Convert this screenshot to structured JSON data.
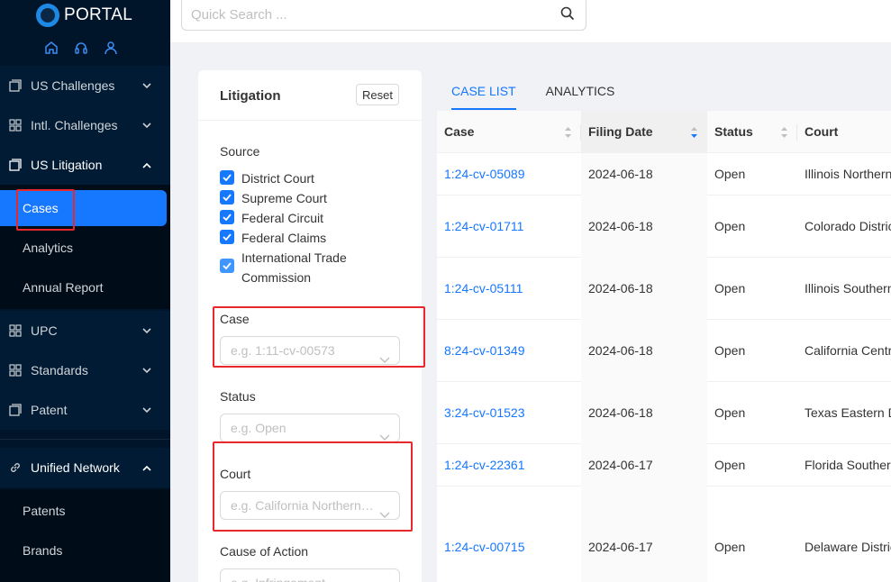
{
  "app": {
    "title": "PORTAL"
  },
  "sidebar": {
    "top_icons": [
      "home-icon",
      "headset-icon",
      "user-icon"
    ],
    "items": [
      {
        "label": "US Challenges",
        "icon": "window-icon",
        "expanded": false
      },
      {
        "label": "Intl. Challenges",
        "icon": "grid-icon",
        "expanded": false
      },
      {
        "label": "US Litigation",
        "icon": "window-icon",
        "expanded": true,
        "children": [
          {
            "label": "Cases",
            "active": true
          },
          {
            "label": "Analytics"
          },
          {
            "label": "Annual Report"
          }
        ]
      },
      {
        "label": "UPC",
        "icon": "grid-icon",
        "expanded": false
      },
      {
        "label": "Standards",
        "icon": "grid-icon",
        "expanded": false
      },
      {
        "label": "Patent",
        "icon": "window-icon",
        "expanded": false
      },
      {
        "label": "Unified Network",
        "icon": "link-icon",
        "expanded": true,
        "children": [
          {
            "label": "Patents"
          },
          {
            "label": "Brands"
          }
        ]
      }
    ]
  },
  "search": {
    "placeholder": "Quick Search ..."
  },
  "filters": {
    "title": "Litigation",
    "reset_label": "Reset",
    "source_label": "Source",
    "sources": [
      "District Court",
      "Supreme Court",
      "Federal Circuit",
      "Federal Claims",
      "International Trade Commission"
    ],
    "case_label": "Case",
    "case_placeholder": "e.g. 1:11-cv-00573",
    "status_label": "Status",
    "status_placeholder": "e.g. Open",
    "court_label": "Court",
    "court_placeholder": "e.g. California Northern District Court",
    "cause_label": "Cause of Action",
    "cause_placeholder": "e.g. Infringement"
  },
  "tabs": [
    {
      "label": "CASE LIST",
      "active": true
    },
    {
      "label": "ANALYTICS",
      "active": false
    }
  ],
  "table": {
    "columns": [
      "Case",
      "Filing Date",
      "Status",
      "Court"
    ],
    "sorted_column": "Filing Date",
    "rows": [
      {
        "case": "1:24-cv-05089",
        "date": "2024-06-18",
        "status": "Open",
        "court": "Illinois Northern District Court"
      },
      {
        "case": "1:24-cv-01711",
        "date": "2024-06-18",
        "status": "Open",
        "court": "Colorado District Court"
      },
      {
        "case": "1:24-cv-05111",
        "date": "2024-06-18",
        "status": "Open",
        "court": "Illinois Southern District Court"
      },
      {
        "case": "8:24-cv-01349",
        "date": "2024-06-18",
        "status": "Open",
        "court": "California Central District Court"
      },
      {
        "case": "3:24-cv-01523",
        "date": "2024-06-18",
        "status": "Open",
        "court": "Texas Eastern District Court"
      },
      {
        "case": "1:24-cv-22361",
        "date": "2024-06-17",
        "status": "Open",
        "court": "Florida Southern District Court"
      },
      {
        "case": "1:24-cv-00715",
        "date": "2024-06-17",
        "status": "Open",
        "court": "Delaware District Court"
      }
    ]
  },
  "colors": {
    "accent": "#1677ff",
    "sidebar_bg": "#001529",
    "highlight_box": "#e8282c"
  }
}
